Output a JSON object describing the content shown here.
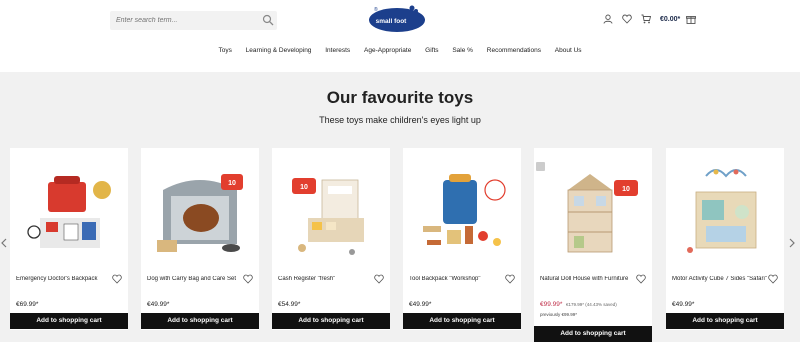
{
  "search": {
    "placeholder": "Enter search term..."
  },
  "logo": {
    "text": "small foot",
    "mark": "®"
  },
  "header": {
    "cart_total": "€0.00*"
  },
  "nav": [
    "Toys",
    "Learning & Developing",
    "Interests",
    "Age-Appropriate",
    "Gifts",
    "Sale %",
    "Recommendations",
    "About Us"
  ],
  "section": {
    "title": "Our favourite toys",
    "subtitle": "These toys make children's eyes light up"
  },
  "products": [
    {
      "name": "Emergency Doctor's Backpack",
      "price": "€69.99*",
      "button": "Add to shopping cart"
    },
    {
      "name": "Dog with Carry Bag and Care Set",
      "price": "€49.99*",
      "button": "Add to shopping cart"
    },
    {
      "name": "Cash Register \"fresh\"",
      "price": "€54.99*",
      "button": "Add to shopping cart"
    },
    {
      "name": "Tool Backpack \"Workshop\"",
      "price": "€49.99*",
      "button": "Add to shopping cart"
    },
    {
      "name": "Natural Doll House with Furniture",
      "price": "€99.99*",
      "old_price": "€179.99* (44.43% saved)",
      "prev_price": "previously €99.99*",
      "button": "Add to shopping cart"
    },
    {
      "name": "Motor Activity Cube 7 Sides \"Safari\"",
      "price": "€49.99*",
      "button": "Add to shopping cart"
    }
  ],
  "colors": {
    "accent": "#1c3f8c",
    "sale": "#c0304a",
    "button": "#111111",
    "background": "#f1f1f1"
  }
}
